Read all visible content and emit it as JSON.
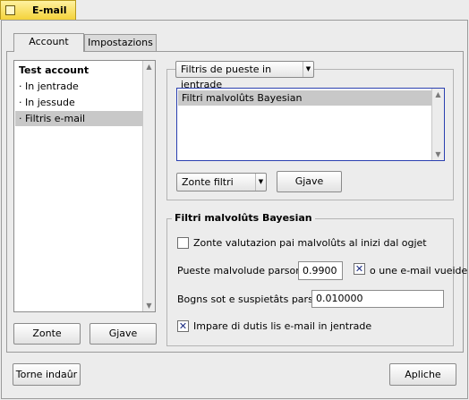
{
  "window": {
    "title": "E-mail"
  },
  "tabs": [
    {
      "label": "Account",
      "active": true
    },
    {
      "label": "Impostazions",
      "active": false
    }
  ],
  "accounts_list": {
    "items": [
      {
        "label": "Test account",
        "bold": true,
        "selected": false
      },
      {
        "label": "· In jentrade",
        "bold": false,
        "selected": false
      },
      {
        "label": "· In jessude",
        "bold": false,
        "selected": false
      },
      {
        "label": "· Filtris e-mail",
        "bold": false,
        "selected": true
      }
    ],
    "add_label": "Zonte",
    "remove_label": "Gjave"
  },
  "filters": {
    "type_select": "Filtris de pueste in jentrade",
    "items": [
      {
        "label": "Filtri malvolûts Bayesian",
        "selected": true
      }
    ],
    "add_select": "Zonte filtri",
    "remove_label": "Gjave"
  },
  "bayesian": {
    "group_title": "Filtri malvolûts Bayesian",
    "add_header_label": "Zonte valutazion pai malvolûts al inizi dal ogjet",
    "add_header_checked": false,
    "spam_threshold_label": "Pueste malvolude parsore:",
    "spam_threshold_value": "0.9900",
    "unknown_label": "o une e-mail vueide",
    "unknown_checked": true,
    "uncertain_label": "Bogns sot e suspietâts parsore:",
    "uncertain_value": "0.010000",
    "learn_label": "Impare di dutis lis e-mail in jentrade",
    "learn_checked": true
  },
  "footer": {
    "revert_label": "Torne indaûr",
    "apply_label": "Apliche"
  },
  "colors": {
    "tab_accent": "#f4d23a",
    "list_border_focus": "#2a3fb0",
    "selection": "#c8c8c8"
  }
}
